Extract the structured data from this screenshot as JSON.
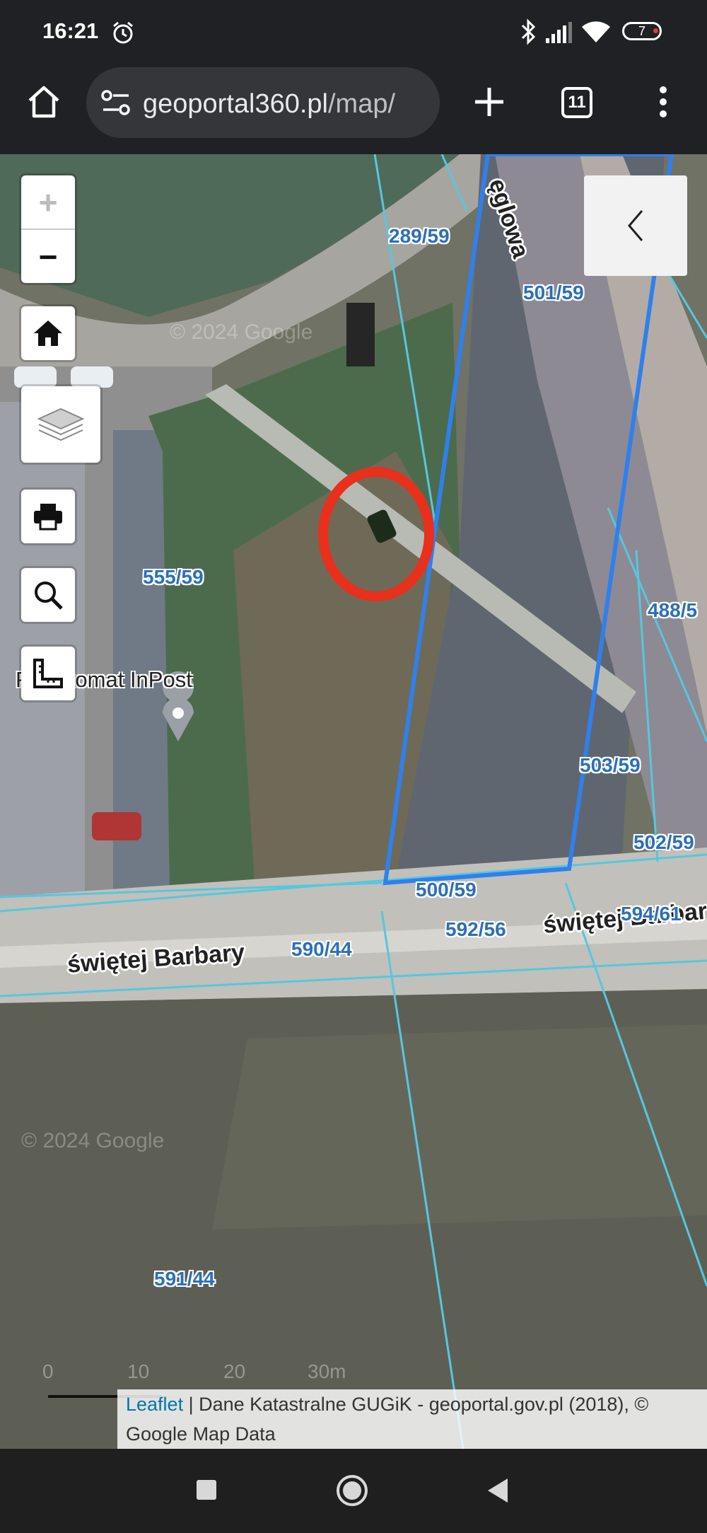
{
  "status_bar": {
    "time": "16:21",
    "battery_level": "7",
    "icons": [
      "alarm-icon",
      "bluetooth-icon",
      "signal-icon",
      "wifi-icon",
      "battery-icon"
    ]
  },
  "browser": {
    "url_host": "geoportal360.pl",
    "url_path": "/map/",
    "tab_count": "11",
    "icons": [
      "home-icon",
      "site-settings-icon",
      "new-tab-icon",
      "tabs-icon",
      "menu-icon"
    ]
  },
  "map": {
    "zoom_in_label": "+",
    "zoom_out_label": "−",
    "controls": [
      "home-icon",
      "layers-icon",
      "print-icon",
      "search-icon",
      "measure-icon"
    ],
    "parcels": [
      {
        "label": "289/59"
      },
      {
        "label": "501/59"
      },
      {
        "label": "555/59"
      },
      {
        "label": "488/5"
      },
      {
        "label": "503/59"
      },
      {
        "label": "502/59"
      },
      {
        "label": "500/59"
      },
      {
        "label": "592/56"
      },
      {
        "label": "594/61"
      },
      {
        "label": "590/44"
      },
      {
        "label": "591/44"
      }
    ],
    "streets": [
      {
        "label": "świętej Barbary"
      },
      {
        "label": "świętej Barbary"
      },
      {
        "label": "ęglowa"
      }
    ],
    "poi": {
      "label": "Paczkomat InPost"
    },
    "watermark": "© 2024 Google",
    "scale_labels": [
      "0",
      "10",
      "20",
      "30m"
    ],
    "attribution": {
      "leaflet": "Leaflet",
      "text": " | Dane Katastralne GUGiK - geoportal.gov.pl (2018), © Google Map Data"
    },
    "highlight_color": "#1a73e8",
    "marker_color": "#e8301c"
  },
  "nav_bar": {
    "icons": [
      "recents-icon",
      "home-circle-icon",
      "back-icon"
    ]
  }
}
